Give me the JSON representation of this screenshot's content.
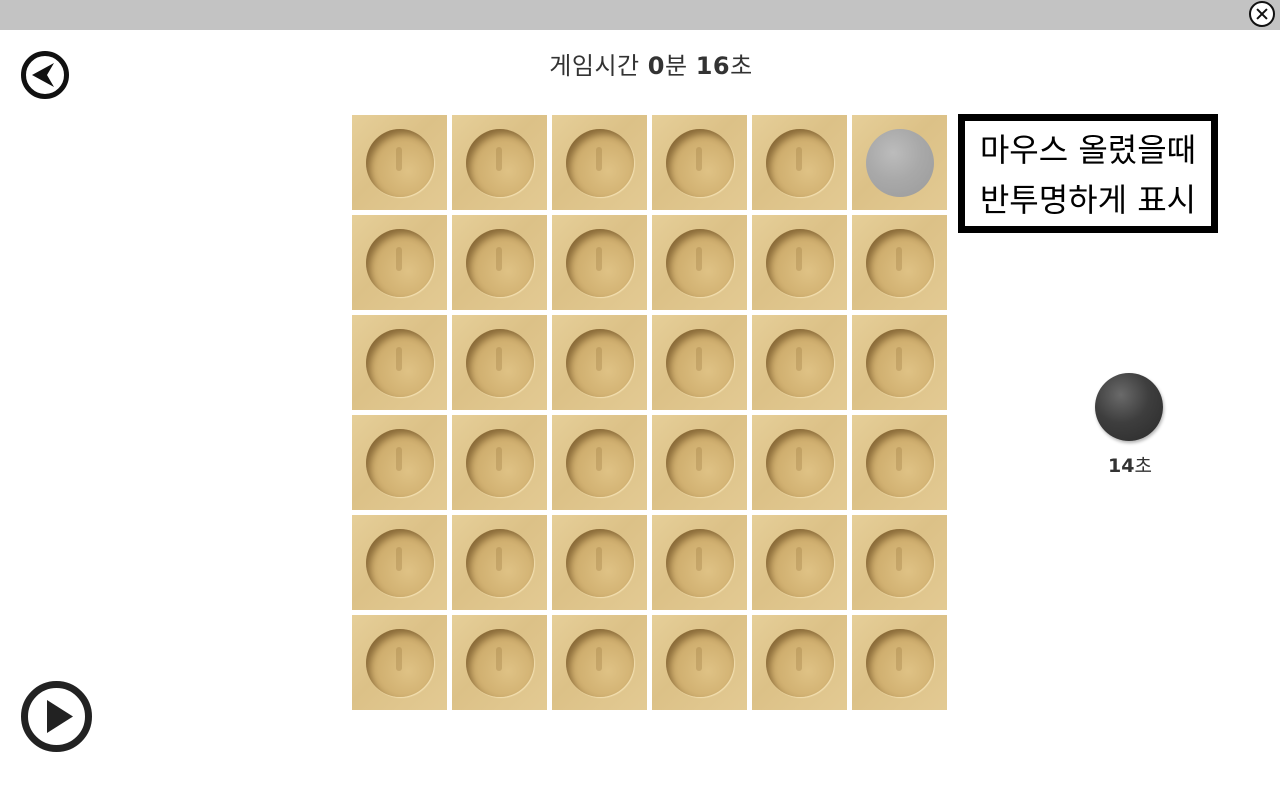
{
  "timer": {
    "label": "게임시간",
    "minutes": "0",
    "minutes_unit": "분",
    "seconds": "16",
    "seconds_unit": "초"
  },
  "hint": {
    "line1": "마우스 올렸을때",
    "line2": "반투명하게 표시"
  },
  "turn": {
    "seconds": "14",
    "unit": "초"
  },
  "board": {
    "rows": 6,
    "cols": 6,
    "hover_preview": {
      "row": 0,
      "col": 5,
      "color": "#a9a9a9"
    }
  },
  "colors": {
    "titlebar": "#c3c3c3",
    "board_tile": "#e2c990",
    "black_stone": "#3e3e3e",
    "hint_border": "#000000"
  },
  "icons": {
    "close": "close-circle-icon",
    "back": "back-arrow-circle-icon",
    "play": "play-circle-icon"
  }
}
